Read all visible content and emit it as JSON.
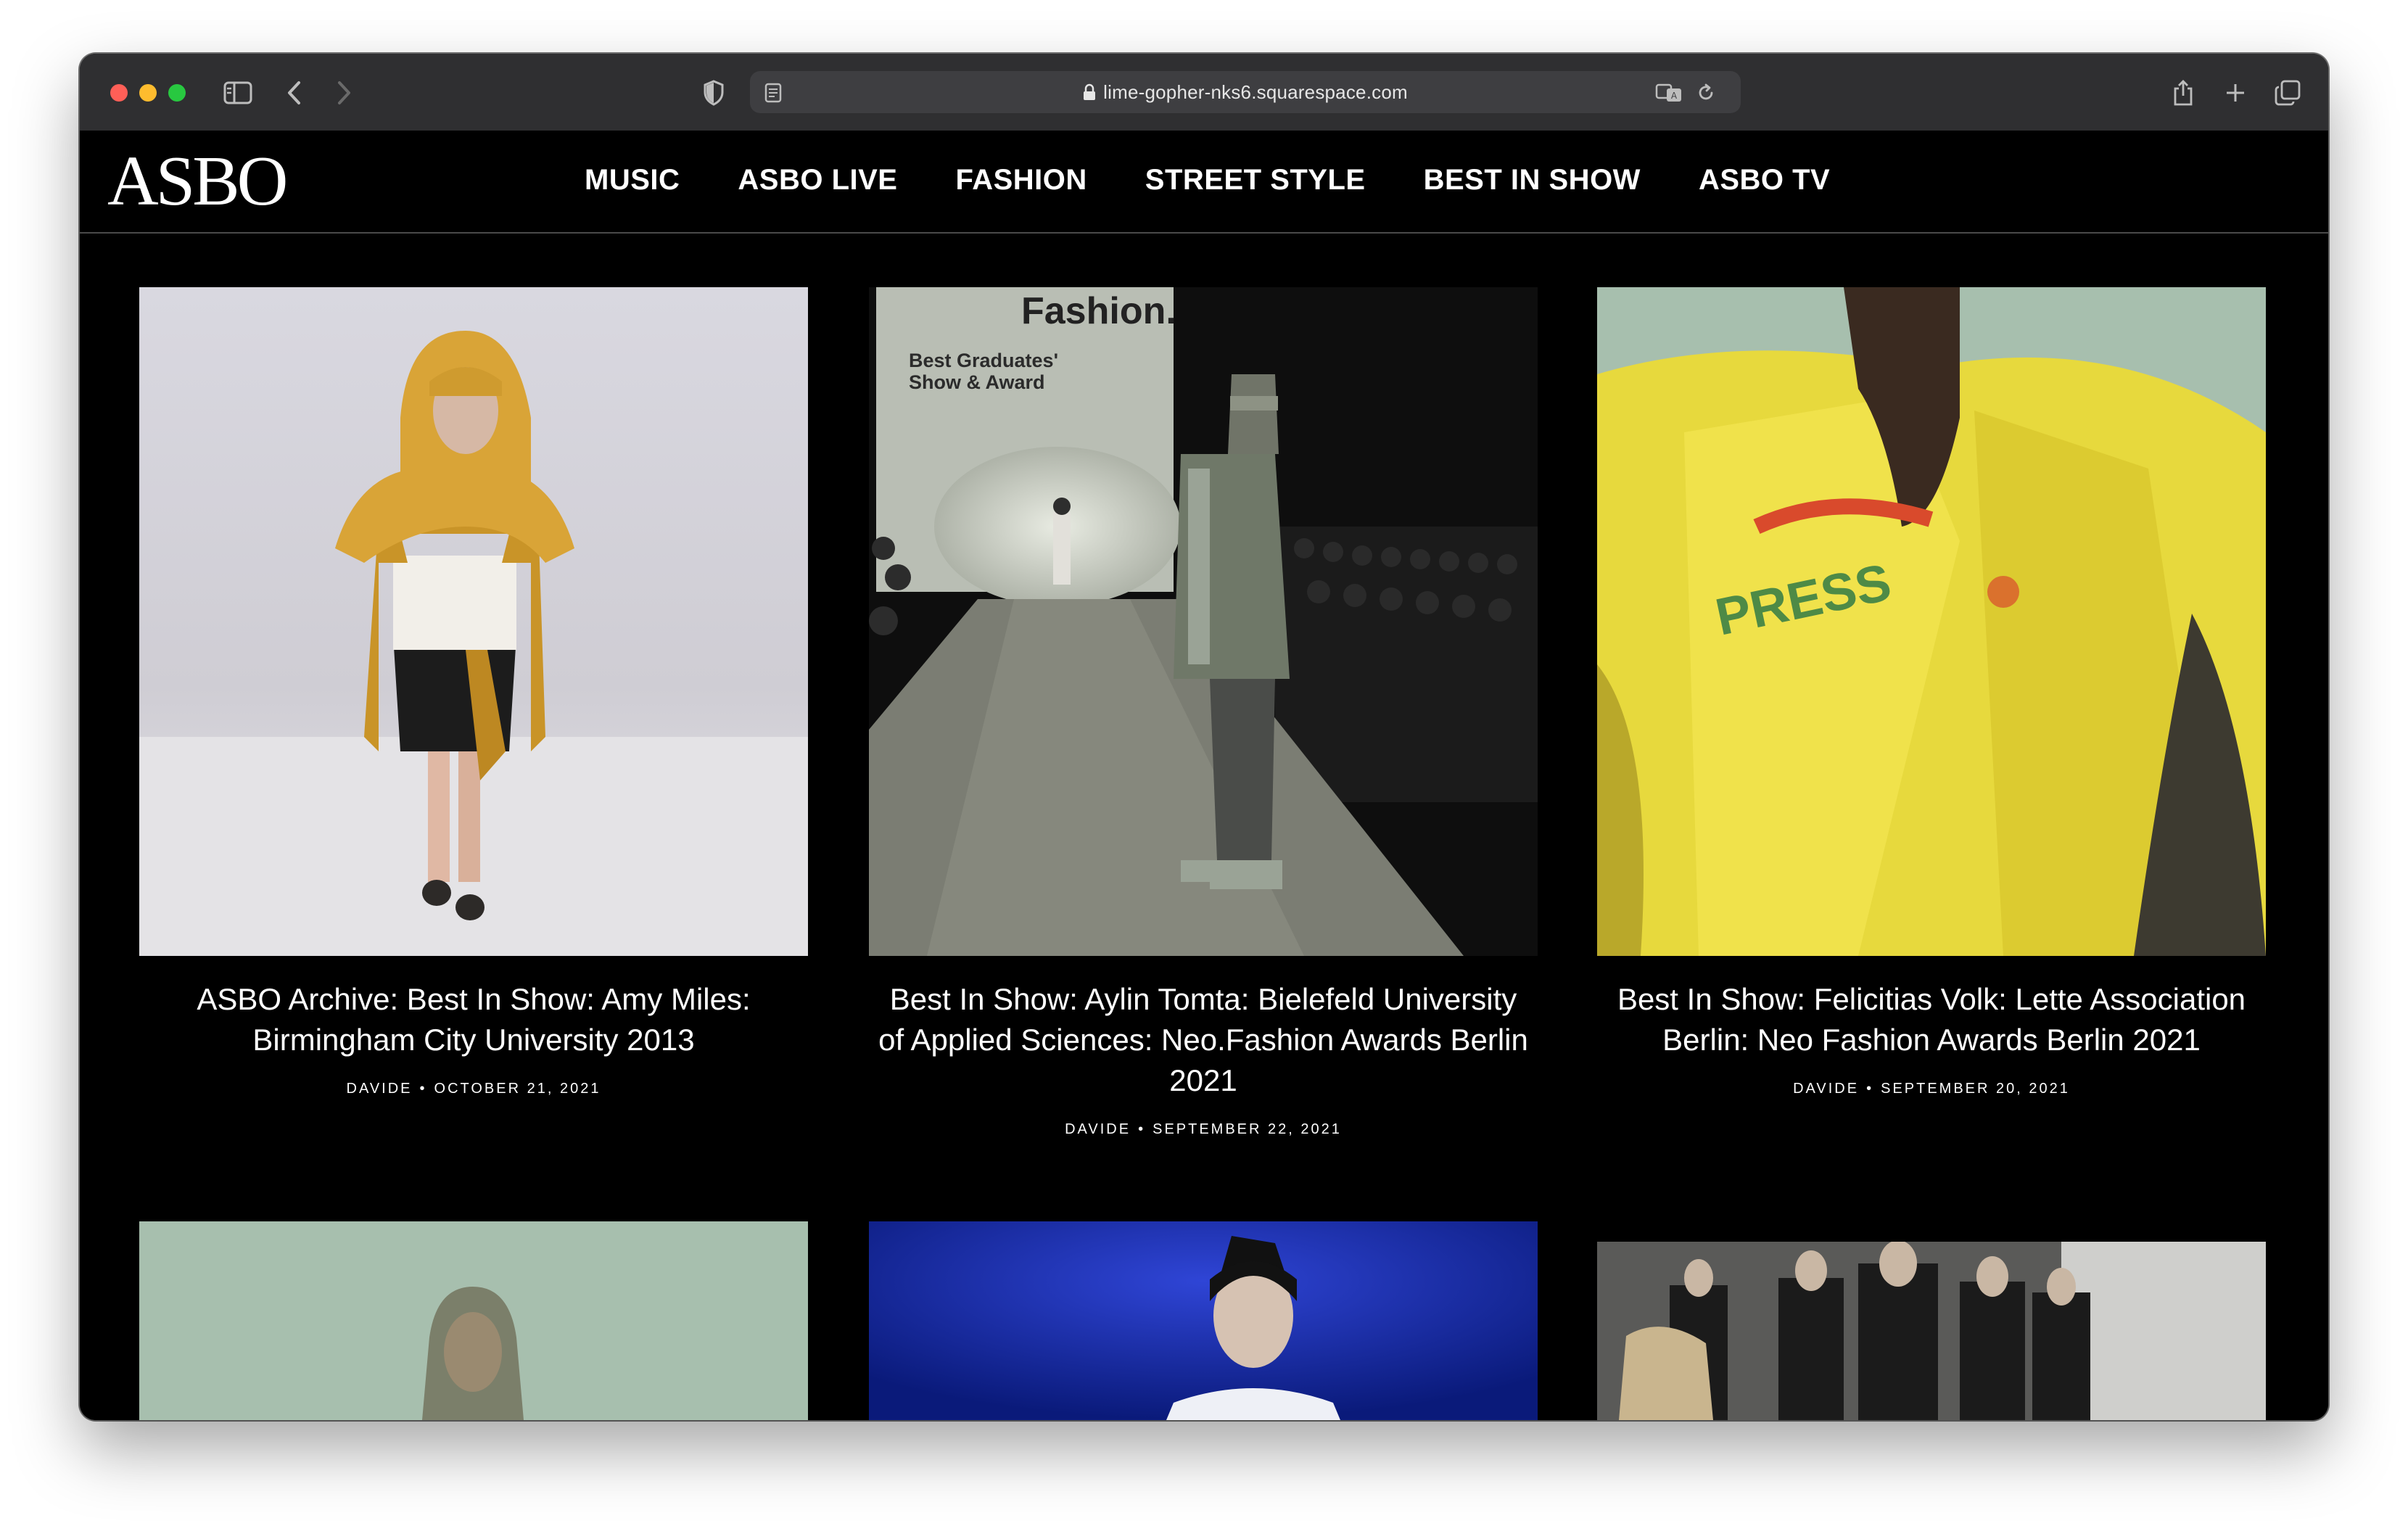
{
  "browser": {
    "url": "lime-gopher-nks6.squarespace.com"
  },
  "site": {
    "logo": "ASBO",
    "nav": [
      "MUSIC",
      "ASBO LIVE",
      "FASHION",
      "STREET STYLE",
      "BEST IN SHOW",
      "ASBO TV"
    ]
  },
  "posts": [
    {
      "title": "ASBO Archive: Best In Show: Amy Miles: Birmingham City University 2013",
      "author": "DAVIDE",
      "date": "OCTOBER 21, 2021"
    },
    {
      "title": "Best In Show: Aylin Tomta: Bielefeld University of Applied Sciences: Neo.Fashion Awards Berlin 2021",
      "author": "DAVIDE",
      "date": "SEPTEMBER 22, 2021",
      "image_text": {
        "brand": "Neo.\nFashion",
        "sub1": "Best Graduates'",
        "sub2": "Show & Award"
      }
    },
    {
      "title": "Best In Show: Felicitias Volk: Lette Association Berlin: Neo Fashion Awards Berlin 2021",
      "author": "DAVIDE",
      "date": "SEPTEMBER 20, 2021"
    }
  ],
  "colors": {
    "page_bg": "#000000",
    "toolbar_bg": "#2f2f31",
    "text": "#ffffff"
  }
}
